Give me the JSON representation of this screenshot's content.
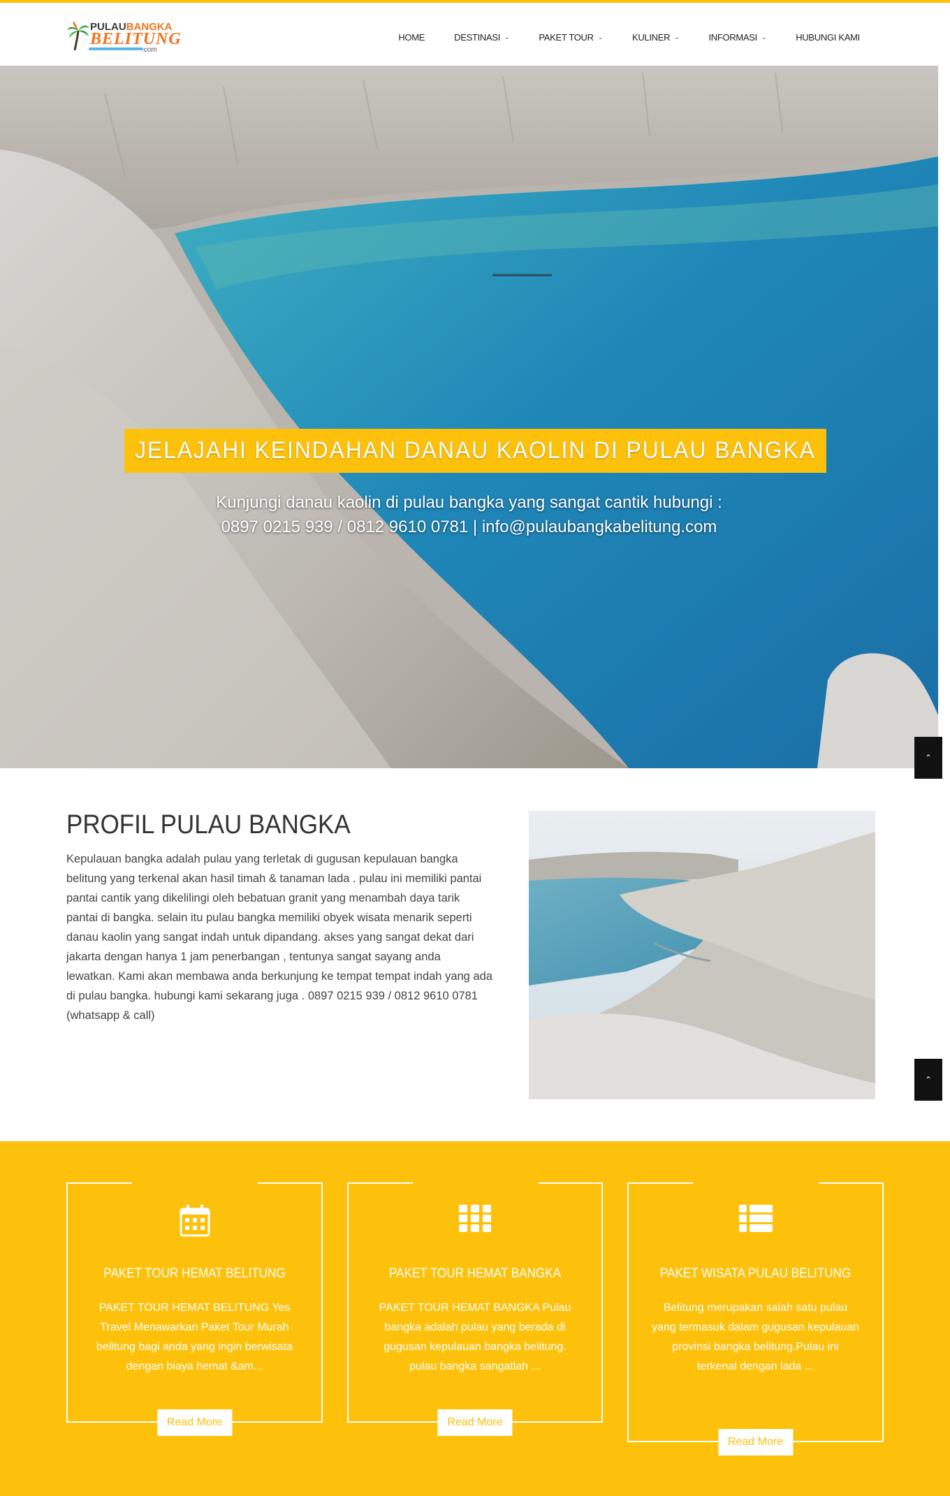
{
  "brand": {
    "line1_a": "PULAU",
    "line1_b": "BANGKA",
    "line2": "BELITUNG",
    "suffix": ".com"
  },
  "nav": [
    {
      "label": "HOME",
      "has_dropdown": false
    },
    {
      "label": "DESTINASI",
      "has_dropdown": true
    },
    {
      "label": "PAKET TOUR",
      "has_dropdown": true
    },
    {
      "label": "KULINER",
      "has_dropdown": true
    },
    {
      "label": "INFORMASI",
      "has_dropdown": true
    },
    {
      "label": "HUBUNGI KAMI",
      "has_dropdown": false
    }
  ],
  "hero": {
    "title": "JELAJAHI KEINDAHAN DANAU KAOLIN DI PULAU BANGKA",
    "subtitle_line1": "Kunjungi danau kaolin di pulau bangka yang sangat cantik hubungi :",
    "subtitle_line2": "0897 0215 939 / 0812 9610 0781 | info@pulaubangkabelitung.com"
  },
  "profile": {
    "title": "PROFIL PULAU BANGKA",
    "text": "Kepulauan bangka adalah pulau yang terletak di gugusan kepulauan bangka belitung yang terkenal akan hasil timah & tanaman lada . pulau ini memiliki pantai pantai cantik yang dikelilingi oleh bebatuan granit yang menambah daya tarik pantai di bangka. selain itu pulau bangka memiliki obyek wisata menarik seperti danau kaolin yang sangat indah untuk dipandang. akses yang sangat dekat dari jakarta dengan hanya 1 jam penerbangan , tentunya sangat sayang anda lewatkan. Kami akan membawa anda berkunjung ke tempat tempat indah yang ada di pulau bangka. hubungi kami sekarang juga . 0897 0215 939 / 0812 9610 0781 (whatsapp & call)"
  },
  "cards": [
    {
      "icon": "calendar-icon",
      "title": "PAKET TOUR HEMAT BELITUNG",
      "text": "PAKET TOUR HEMAT BELITUNG Yes Travel Menawarkan Paket Tour Murah belitung bagi anda yang ingin berwisata dengan biaya hemat &am...",
      "button": "Read More"
    },
    {
      "icon": "grid-icon",
      "title": "PAKET TOUR HEMAT BANGKA",
      "text": "PAKET TOUR HEMAT BANGKA Pulau bangka adalah pulau yang berada di gugusan kepulauan bangka belitung. pulau bangka sangatlah ...",
      "button": "Read More"
    },
    {
      "icon": "list-icon",
      "title": "PAKET WISATA PULAU BELITUNG",
      "text": "Belitung merupakan salah satu pulau yang termasuk dalam gugusan kepulauan provinsi bangka belitung.Pulau ini terkenal dengan lada ...",
      "button": "Read More"
    }
  ],
  "colors": {
    "accent": "#fdc10c",
    "dark": "#111111"
  }
}
